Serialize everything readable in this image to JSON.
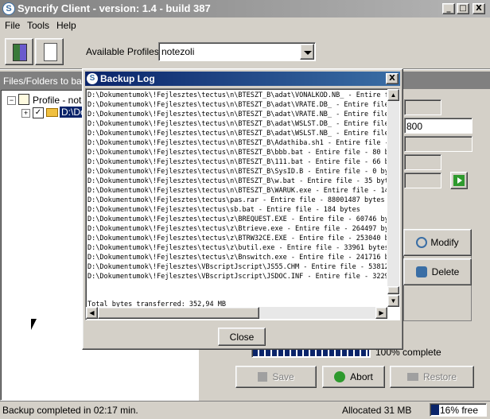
{
  "window": {
    "title": "Syncrify Client - version: 1.4 - build 387",
    "min": "_",
    "max": "□",
    "close": "X"
  },
  "menu": [
    {
      "label": "File"
    },
    {
      "label": "Tools"
    },
    {
      "label": "Help"
    }
  ],
  "profiles": {
    "label": "Available Profiles:",
    "value": "notezoli"
  },
  "left_panel": {
    "header": "Files/Folders to back",
    "profile_node": "Profile - note",
    "drive_node": "D:\\Do"
  },
  "right_panel": {
    "field_value": "800",
    "progress_label": "100% complete",
    "progress": 1.0
  },
  "side_buttons": {
    "modify": "Modify",
    "delete": "Delete"
  },
  "bottom_buttons": {
    "save": "Save",
    "abort": "Abort",
    "restore": "Restore"
  },
  "status": {
    "left": "Backup completed in 02:17 min.",
    "allocated": "Allocated 31 MB",
    "free": "16% free"
  },
  "dialog": {
    "title": "Backup Log",
    "close_x": "X",
    "close_button": "Close",
    "log_lines": [
      "D:\\Dokumentumok\\!Fejlesztes\\tectus\\n\\BTESZT_B\\adat\\VONALKOD.NB_ - Entire fil",
      "D:\\Dokumentumok\\!Fejlesztes\\tectus\\n\\BTESZT_B\\adat\\VRATE.DB_ - Entire file -",
      "D:\\Dokumentumok\\!Fejlesztes\\tectus\\n\\BTESZT_B\\adat\\VRATE.NB_ - Entire file -",
      "D:\\Dokumentumok\\!Fejlesztes\\tectus\\n\\BTESZT_B\\adat\\WSLST.DB_ - Entire file -",
      "D:\\Dokumentumok\\!Fejlesztes\\tectus\\n\\BTESZT_B\\adat\\WSLST.NB_ - Entire file -",
      "D:\\Dokumentumok\\!Fejlesztes\\tectus\\n\\BTESZT_B\\Adathiba.sh1 - Entire file - 4",
      "D:\\Dokumentumok\\!Fejlesztes\\tectus\\n\\BTESZT_B\\bbb.bat - Entire file - 80 byte",
      "D:\\Dokumentumok\\!Fejlesztes\\tectus\\n\\BTESZT_B\\111.bat - Entire file - 66 byte",
      "D:\\Dokumentumok\\!Fejlesztes\\tectus\\n\\BTESZT_B\\SysID.B - Entire file - 0 byte",
      "D:\\Dokumentumok\\!Fejlesztes\\tectus\\n\\BTESZT_B\\w.bat - Entire file - 35 bytes",
      "D:\\Dokumentumok\\!Fejlesztes\\tectus\\n\\BTESZT_B\\WARUK.exe - Entire file - 1420",
      "D:\\Dokumentumok\\!Fejlesztes\\tectus\\pas.rar - Entire file - 88001487 bytes",
      "D:\\Dokumentumok\\!Fejlesztes\\tectus\\sb.bat - Entire file - 184 bytes",
      "D:\\Dokumentumok\\!Fejlesztes\\tectus\\z\\BREQUEST.EXE - Entire file - 60746 byte",
      "D:\\Dokumentumok\\!Fejlesztes\\tectus\\z\\Btrieve.exe - Entire file - 264497 byte",
      "D:\\Dokumentumok\\!Fejlesztes\\tectus\\z\\BTRW32CE.EXE - Entire file - 253040 byt",
      "D:\\Dokumentumok\\!Fejlesztes\\tectus\\z\\butil.exe - Entire file - 33961 bytes",
      "D:\\Dokumentumok\\!Fejlesztes\\tectus\\z\\Bnswitch.exe - Entire file - 241716 byt",
      "D:\\Dokumentumok\\!Fejlesztes\\VBscriptJscript\\JS55.CHM - Entire file - 538122",
      "D:\\Dokumentumok\\!Fejlesztes\\VBscriptJscript\\JSDOC.INF - Entire file - 3229 b"
    ],
    "total": "Total bytes transferred: 352,94 MB"
  }
}
